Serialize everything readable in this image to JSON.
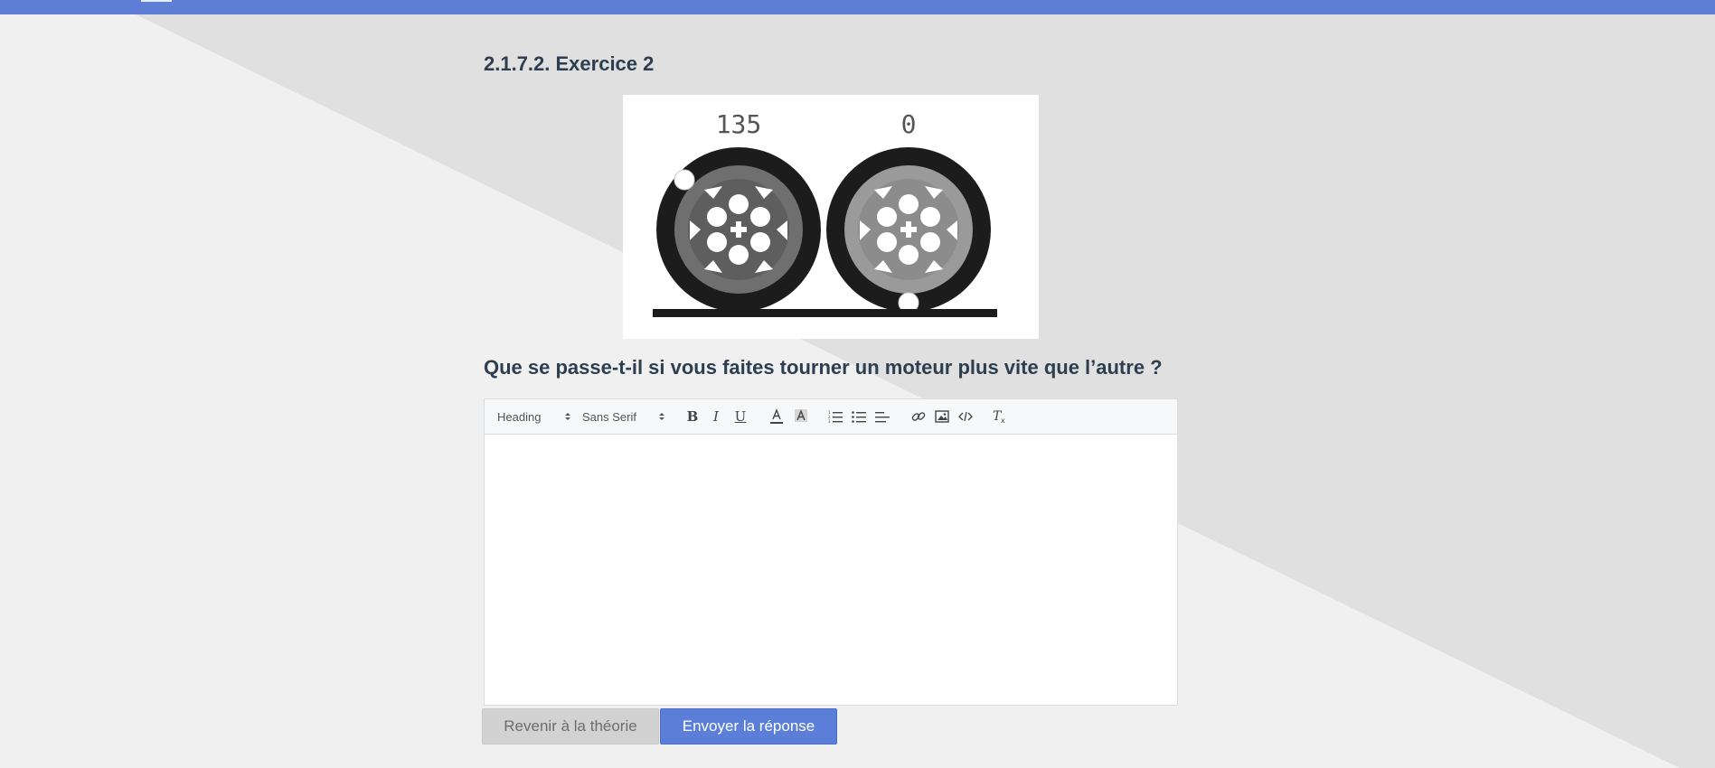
{
  "header": {
    "accent_color": "#5f7fd6"
  },
  "exercise": {
    "title": "2.1.7.2. Exercice 2",
    "figure": {
      "left_wheel_value": "135",
      "right_wheel_value": "0"
    },
    "question": "Que se passe-t-il si vous faites tourner un moteur plus vite que l’autre ?"
  },
  "editor": {
    "heading_picker": "Heading",
    "font_picker": "Sans Serif",
    "toolbar_icons": [
      "bold-icon",
      "italic-icon",
      "underline-icon",
      "text-color-icon",
      "background-color-icon",
      "ordered-list-icon",
      "bullet-list-icon",
      "align-icon",
      "link-icon",
      "image-icon",
      "code-icon",
      "clear-format-icon"
    ],
    "bold_label": "B",
    "italic_label": "I",
    "underline_label": "U",
    "content": ""
  },
  "actions": {
    "back_label": "Revenir à la théorie",
    "submit_label": "Envoyer la réponse",
    "back_color": "#d2d2d2",
    "submit_color": "#5b7fd8"
  }
}
